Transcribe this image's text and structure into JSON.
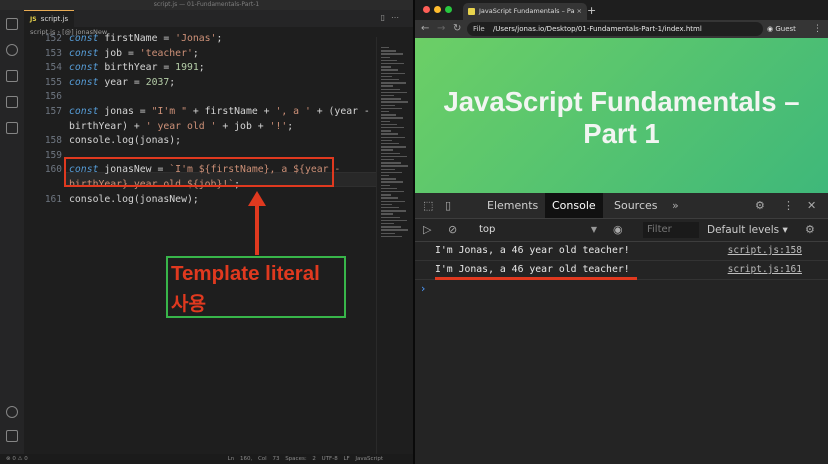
{
  "vscode": {
    "title": "script.js — 01-Fundamentals-Part-1",
    "tab_label": "script.js",
    "tab_icon": "JS",
    "breadcrumb": "script.js › [@] jonasNew",
    "lines": [
      {
        "num": "152",
        "tokens": [
          [
            "kw",
            "const "
          ],
          [
            "var",
            "firstName = "
          ],
          [
            "str",
            "'Jonas'"
          ],
          [
            "plain",
            ";"
          ]
        ]
      },
      {
        "num": "153",
        "tokens": [
          [
            "kw",
            "const "
          ],
          [
            "var",
            "job = "
          ],
          [
            "str",
            "'teacher'"
          ],
          [
            "plain",
            ";"
          ]
        ]
      },
      {
        "num": "154",
        "tokens": [
          [
            "kw",
            "const "
          ],
          [
            "var",
            "birthYear = "
          ],
          [
            "num",
            "1991"
          ],
          [
            "plain",
            ";"
          ]
        ]
      },
      {
        "num": "155",
        "tokens": [
          [
            "kw",
            "const "
          ],
          [
            "var",
            "year = "
          ],
          [
            "num",
            "2037"
          ],
          [
            "plain",
            ";"
          ]
        ]
      },
      {
        "num": "156",
        "tokens": []
      },
      {
        "num": "157",
        "tokens": [
          [
            "kw",
            "const "
          ],
          [
            "var",
            "jonas = "
          ],
          [
            "str",
            "\"I'm \""
          ],
          [
            "plain",
            " + firstName + "
          ],
          [
            "str",
            "', a '"
          ],
          [
            "plain",
            " + (year -"
          ]
        ]
      },
      {
        "num": "",
        "tokens": [
          [
            "plain",
            "birthYear) + "
          ],
          [
            "str",
            "' year old '"
          ],
          [
            "plain",
            " + job + "
          ],
          [
            "str",
            "'!'"
          ],
          [
            "plain",
            ";"
          ]
        ]
      },
      {
        "num": "158",
        "tokens": [
          [
            "plain",
            "console.log(jonas);"
          ]
        ]
      },
      {
        "num": "159",
        "tokens": []
      },
      {
        "num": "160",
        "tokens": [
          [
            "kw",
            "const "
          ],
          [
            "var",
            "jonasNew = "
          ],
          [
            "str",
            "`I'm ${firstName}, a ${year -"
          ]
        ]
      },
      {
        "num": "",
        "tokens": [
          [
            "str",
            "birthYear} year old ${job}!`"
          ],
          [
            "plain",
            ";"
          ]
        ]
      },
      {
        "num": "161",
        "tokens": [
          [
            "plain",
            "console.log(jonasNew);"
          ]
        ]
      }
    ],
    "annotation": {
      "line1": "Template literal",
      "line2": "사용"
    },
    "status_left": "⊗ 0 ⚠ 0",
    "status_right": "Ln 160, Col 73   Spaces: 2   UTF-8   LF   JavaScript"
  },
  "browser": {
    "tab_title": "JavaScript Fundamentals – Pa",
    "url_scheme": "File",
    "url": "/Users/jonas.io/Desktop/01-Fundamentals-Part-1/index.html",
    "profile": "Guest",
    "page_heading": "JavaScript Fundamentals – Part 1",
    "devtools": {
      "tabs": [
        "Elements",
        "Console",
        "Sources"
      ],
      "active_tab": "Console",
      "context": "top",
      "filter_placeholder": "Filter",
      "levels": "Default levels ▾",
      "messages": [
        {
          "text": "I'm Jonas, a 46 year old teacher!",
          "source": "script.js:158"
        },
        {
          "text": "I'm Jonas, a 46 year old teacher!",
          "source": "script.js:161"
        }
      ],
      "prompt": "›"
    }
  },
  "colors": {
    "annotation_red": "#e0391f",
    "annotation_green": "#38b54a",
    "page_green": "#5cc56f"
  }
}
